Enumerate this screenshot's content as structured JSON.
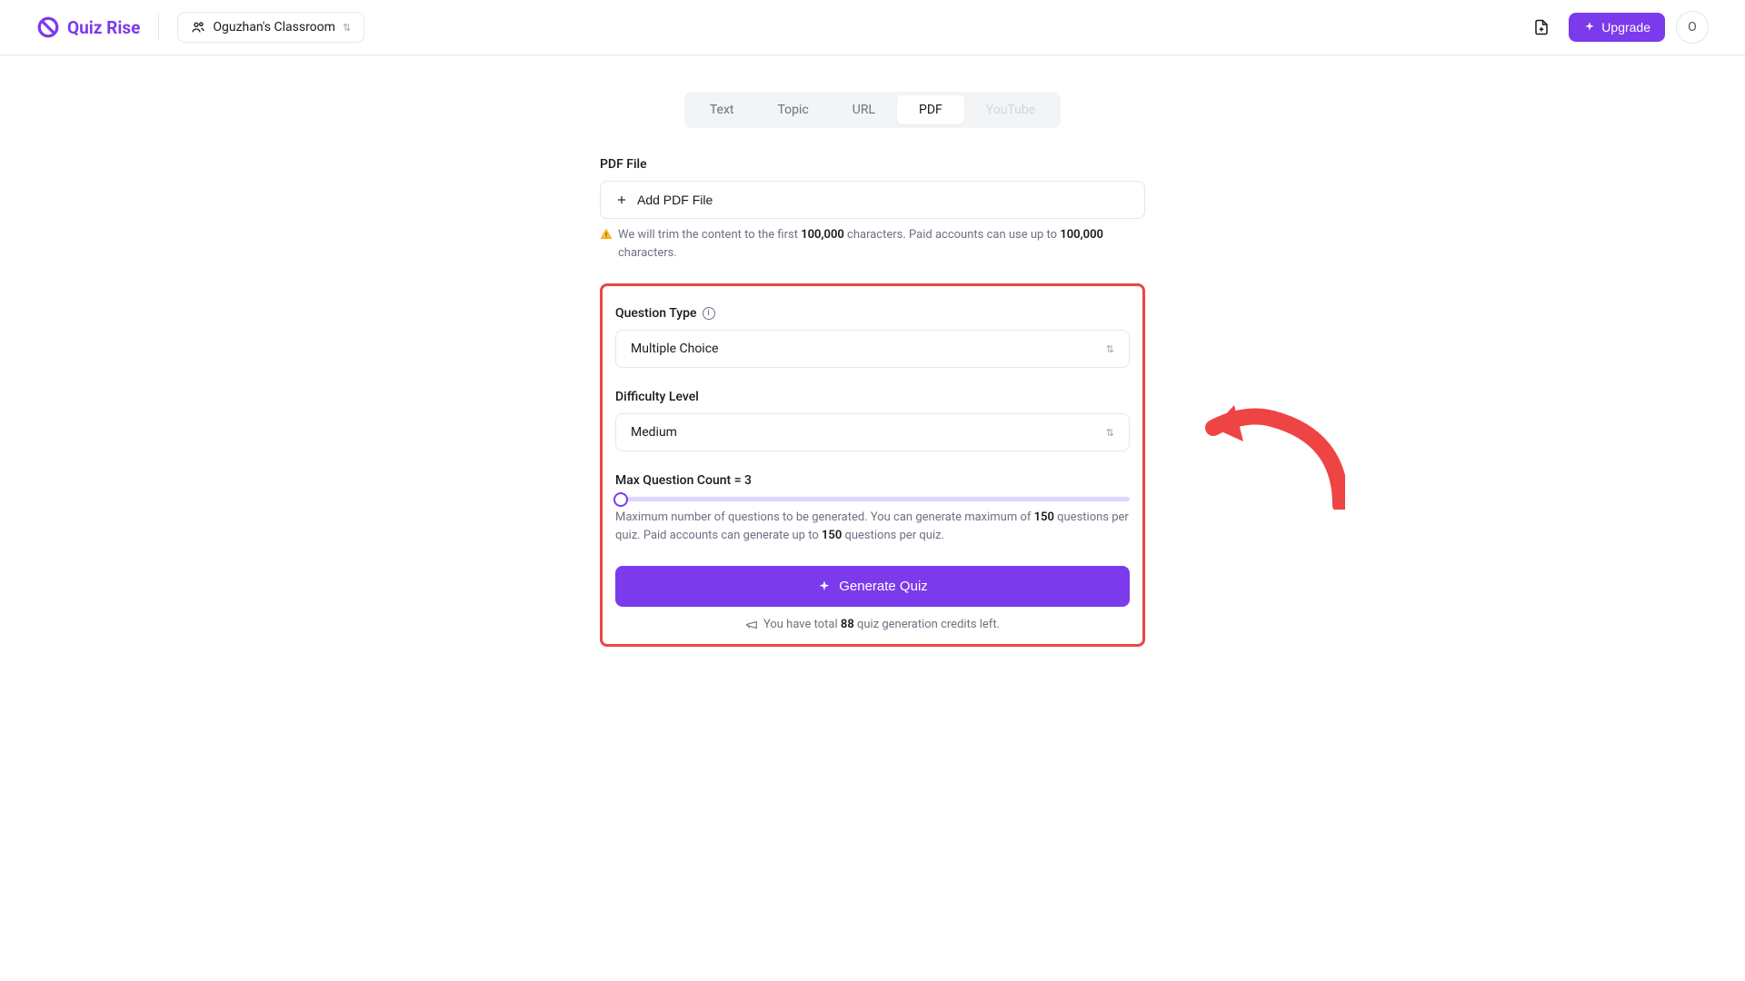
{
  "header": {
    "logo_text": "Quiz Rise",
    "classroom_name": "Oguzhan's Classroom",
    "upgrade_label": "Upgrade",
    "avatar_initial": "O"
  },
  "tabs": [
    {
      "label": "Text",
      "active": false
    },
    {
      "label": "Topic",
      "active": false
    },
    {
      "label": "URL",
      "active": false
    },
    {
      "label": "PDF",
      "active": true
    },
    {
      "label": "YouTube",
      "active": false,
      "disabled": true
    }
  ],
  "pdf_section": {
    "label": "PDF File",
    "add_button_label": "Add PDF File",
    "trim_warning_prefix": "We will trim the content to the first ",
    "trim_limit_1": "100,000",
    "trim_warning_mid": " characters. Paid accounts can use up to ",
    "trim_limit_2": "100,000",
    "trim_warning_suffix": " characters."
  },
  "question_type": {
    "label": "Question Type",
    "value": "Multiple Choice"
  },
  "difficulty": {
    "label": "Difficulty Level",
    "value": "Medium"
  },
  "max_count": {
    "label": "Max Question Count = 3",
    "help_prefix": "Maximum number of questions to be generated. You can generate maximum of ",
    "help_limit_1": "150",
    "help_mid": " questions per quiz. Paid accounts can generate up to ",
    "help_limit_2": "150",
    "help_suffix": " questions per quiz."
  },
  "generate_button_label": "Generate Quiz",
  "credits": {
    "prefix": "You have total ",
    "count": "88",
    "suffix": " quiz generation credits left."
  }
}
